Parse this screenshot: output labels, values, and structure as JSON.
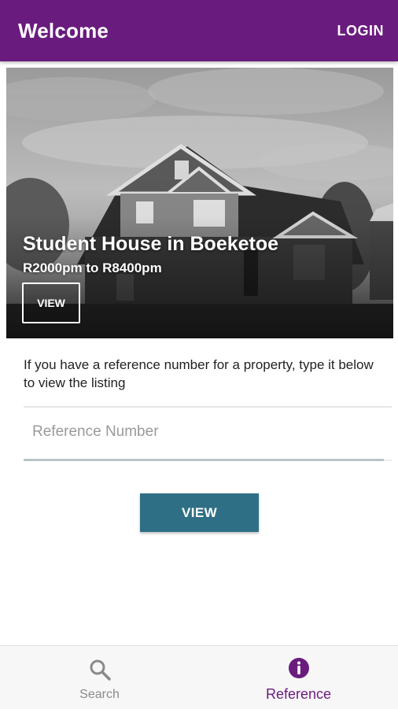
{
  "app_bar": {
    "title": "Welcome",
    "login_label": "LOGIN",
    "color": "#6a1b7e"
  },
  "featured": {
    "name": "Student House in Boeketoe",
    "price": "R2000pm to R8400pm",
    "view_label": "VIEW"
  },
  "reference": {
    "instructions": "If you have a reference number for a property, type it below to view the listing",
    "placeholder": "Reference Number",
    "value": "",
    "button_label": "VIEW",
    "button_color": "#2f6f85"
  },
  "bottom_nav": {
    "items": [
      {
        "label": "Search",
        "icon": "search-icon",
        "active": false
      },
      {
        "label": "Reference",
        "icon": "info-icon",
        "active": true
      }
    ]
  }
}
